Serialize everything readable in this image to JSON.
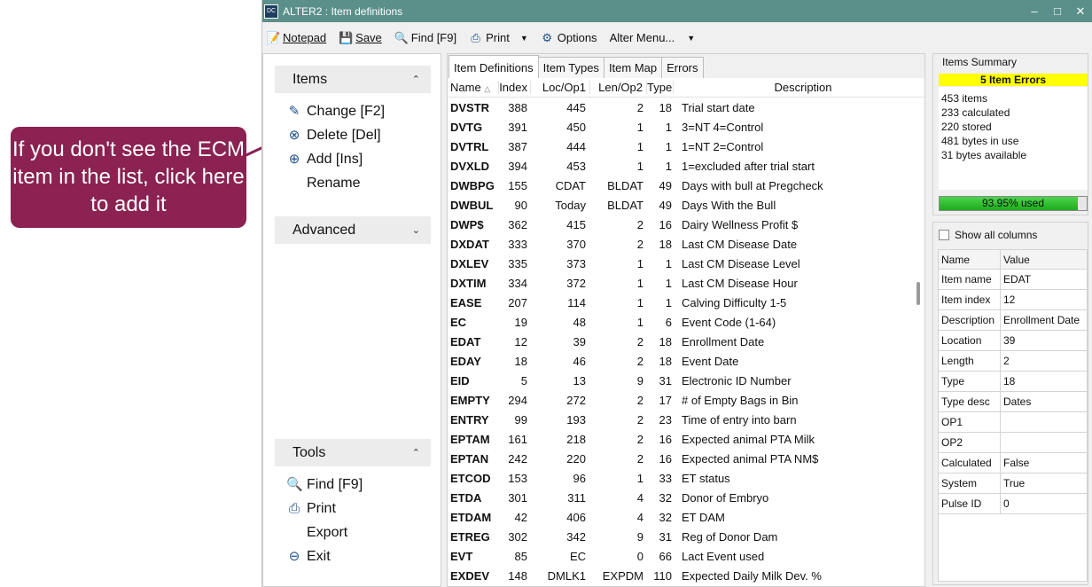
{
  "callout": {
    "text": "If you don't see the ECM item in the list, click here to add it"
  },
  "window": {
    "title": "ALTER2 : Item definitions",
    "icon_text": "DC"
  },
  "toolbar": {
    "notepad": "Notepad",
    "save": "Save",
    "find": "Find [F9]",
    "print": "Print",
    "options": "Options",
    "alter_menu": "Alter Menu..."
  },
  "left": {
    "items_header": "Items",
    "items": [
      {
        "label": "Change [F2]",
        "icon": "edit-icon"
      },
      {
        "label": "Delete [Del]",
        "icon": "delete-icon"
      },
      {
        "label": "Add [Ins]",
        "icon": "add-icon"
      },
      {
        "label": "Rename",
        "icon": ""
      }
    ],
    "advanced_header": "Advanced",
    "tools_header": "Tools",
    "tools": [
      {
        "label": "Find [F9]",
        "icon": "search-icon"
      },
      {
        "label": "Print",
        "icon": "printer-icon"
      },
      {
        "label": "Export",
        "icon": ""
      },
      {
        "label": "Exit",
        "icon": "exit-icon"
      }
    ]
  },
  "tabs": [
    "Item Definitions",
    "Item Types",
    "Item Map",
    "Errors"
  ],
  "grid": {
    "headers": {
      "name": "Name",
      "index": "Index",
      "loc": "Loc/Op1",
      "len": "Len/Op2",
      "type": "Type",
      "desc": "Description"
    },
    "rows": [
      {
        "name": "DVSTR",
        "index": "388",
        "loc": "445",
        "len": "2",
        "type": "18",
        "desc": "Trial start date"
      },
      {
        "name": "DVTG",
        "index": "391",
        "loc": "450",
        "len": "1",
        "type": "1",
        "desc": "3=NT 4=Control"
      },
      {
        "name": "DVTRL",
        "index": "387",
        "loc": "444",
        "len": "1",
        "type": "1",
        "desc": "1=NT 2=Control"
      },
      {
        "name": "DVXLD",
        "index": "394",
        "loc": "453",
        "len": "1",
        "type": "1",
        "desc": "1=excluded after trial start"
      },
      {
        "name": "DWBPG",
        "index": "155",
        "loc": "CDAT",
        "len": "BLDAT",
        "type": "49",
        "desc": "Days with bull at Pregcheck"
      },
      {
        "name": "DWBUL",
        "index": "90",
        "loc": "Today",
        "len": "BLDAT",
        "type": "49",
        "desc": "Days With the Bull"
      },
      {
        "name": "DWP$",
        "index": "362",
        "loc": "415",
        "len": "2",
        "type": "16",
        "desc": "Dairy Wellness Profit $"
      },
      {
        "name": "DXDAT",
        "index": "333",
        "loc": "370",
        "len": "2",
        "type": "18",
        "desc": "Last CM Disease Date"
      },
      {
        "name": "DXLEV",
        "index": "335",
        "loc": "373",
        "len": "1",
        "type": "1",
        "desc": "Last CM Disease Level"
      },
      {
        "name": "DXTIM",
        "index": "334",
        "loc": "372",
        "len": "1",
        "type": "1",
        "desc": "Last CM Disease Hour"
      },
      {
        "name": "EASE",
        "index": "207",
        "loc": "114",
        "len": "1",
        "type": "1",
        "desc": "Calving Difficulty 1-5"
      },
      {
        "name": "EC",
        "index": "19",
        "loc": "48",
        "len": "1",
        "type": "6",
        "desc": "Event Code (1-64)"
      },
      {
        "name": "EDAT",
        "index": "12",
        "loc": "39",
        "len": "2",
        "type": "18",
        "desc": "Enrollment Date"
      },
      {
        "name": "EDAY",
        "index": "18",
        "loc": "46",
        "len": "2",
        "type": "18",
        "desc": "Event Date"
      },
      {
        "name": "EID",
        "index": "5",
        "loc": "13",
        "len": "9",
        "type": "31",
        "desc": "Electronic ID Number"
      },
      {
        "name": "EMPTY",
        "index": "294",
        "loc": "272",
        "len": "2",
        "type": "17",
        "desc": "# of Empty Bags in Bin"
      },
      {
        "name": "ENTRY",
        "index": "99",
        "loc": "193",
        "len": "2",
        "type": "23",
        "desc": "Time of entry into barn"
      },
      {
        "name": "EPTAM",
        "index": "161",
        "loc": "218",
        "len": "2",
        "type": "16",
        "desc": "Expected animal PTA Milk"
      },
      {
        "name": "EPTAN",
        "index": "242",
        "loc": "220",
        "len": "2",
        "type": "16",
        "desc": "Expected animal PTA NM$"
      },
      {
        "name": "ETCOD",
        "index": "153",
        "loc": "96",
        "len": "1",
        "type": "33",
        "desc": "ET status"
      },
      {
        "name": "ETDA",
        "index": "301",
        "loc": "311",
        "len": "4",
        "type": "32",
        "desc": "Donor of Embryo"
      },
      {
        "name": "ETDAM",
        "index": "42",
        "loc": "406",
        "len": "4",
        "type": "32",
        "desc": "ET DAM"
      },
      {
        "name": "ETREG",
        "index": "302",
        "loc": "342",
        "len": "9",
        "type": "31",
        "desc": "Reg of Donor Dam"
      },
      {
        "name": "EVT",
        "index": "85",
        "loc": "EC",
        "len": "0",
        "type": "66",
        "desc": "Lact Event used"
      },
      {
        "name": "EXDEV",
        "index": "148",
        "loc": "DMLK1",
        "len": "EXPDM",
        "type": "110",
        "desc": "Expected Daily Milk Dev. %"
      }
    ]
  },
  "summary": {
    "title": "Items Summary",
    "errors": "5 Item Errors",
    "stats": [
      "453 items",
      "233 calculated",
      "220 stored",
      "481 bytes in use",
      "31 bytes available"
    ],
    "used_label": "93.95% used",
    "used_fraction": 0.9395,
    "error_color": "#ffff00",
    "progress_color": "#2fbf2f"
  },
  "props": {
    "show_all": "Show all columns",
    "headers": {
      "name": "Name",
      "value": "Value"
    },
    "rows": [
      {
        "k": "Item name",
        "v": "EDAT"
      },
      {
        "k": "Item index",
        "v": "12"
      },
      {
        "k": "Description",
        "v": "Enrollment Date"
      },
      {
        "k": "Location",
        "v": "39"
      },
      {
        "k": "Length",
        "v": "2"
      },
      {
        "k": "Type",
        "v": "18"
      },
      {
        "k": "Type desc",
        "v": "Dates"
      },
      {
        "k": "OP1",
        "v": ""
      },
      {
        "k": "OP2",
        "v": ""
      },
      {
        "k": "Calculated",
        "v": "False"
      },
      {
        "k": "System",
        "v": "True"
      },
      {
        "k": "Pulse ID",
        "v": "0"
      }
    ]
  }
}
